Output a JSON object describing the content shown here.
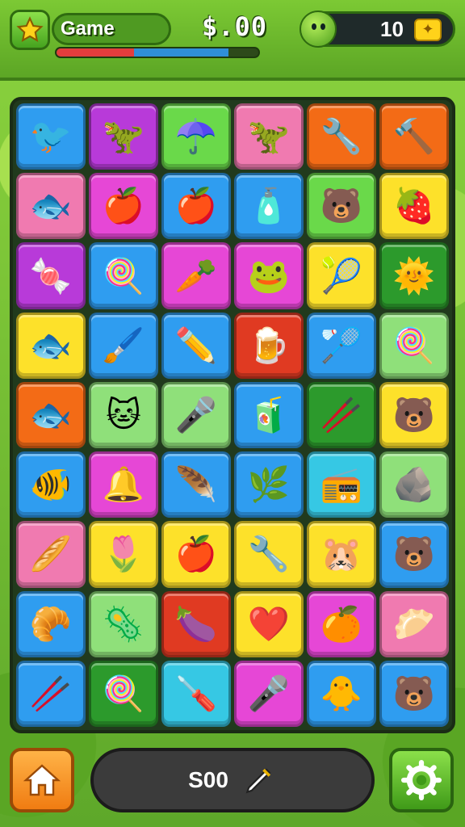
{
  "header": {
    "player_name": "Game",
    "money": "$.00",
    "progress": 0.85,
    "level": "10",
    "coin_icon": "coin-icon"
  },
  "footer": {
    "score": "S00"
  },
  "colors": {
    "blue": "#2f9df0",
    "purple": "#b83ad9",
    "green": "#6ad94a",
    "pink": "#f07ab0",
    "orange": "#f36b16",
    "yellow": "#fde12a",
    "magenta": "#e647d6",
    "dkgreen": "#2c9a2c",
    "red": "#e03a22",
    "teal": "#36c8e4",
    "ltgreen": "#8fe07a"
  },
  "board": {
    "rows": [
      [
        [
          "blue",
          "🐦"
        ],
        [
          "purple",
          "🦖"
        ],
        [
          "green",
          "☂️"
        ],
        [
          "pink",
          "🦖"
        ],
        [
          "orange",
          "🔧"
        ],
        [
          "orange",
          "🔨"
        ]
      ],
      [
        [
          "pink",
          "🐟"
        ],
        [
          "magenta",
          "🍎"
        ],
        [
          "blue",
          "🍎"
        ],
        [
          "blue",
          "🧴"
        ],
        [
          "green",
          "🐻"
        ],
        [
          "yellow",
          "🍓"
        ]
      ],
      [
        [
          "purple",
          "🍬"
        ],
        [
          "blue",
          "🍭"
        ],
        [
          "magenta",
          "🥕"
        ],
        [
          "magenta",
          "🐸"
        ],
        [
          "yellow",
          "🎾"
        ],
        [
          "dkgreen",
          "🌞"
        ]
      ],
      [
        [
          "yellow",
          "🐟"
        ],
        [
          "blue",
          "🖌️"
        ],
        [
          "blue",
          "✏️"
        ],
        [
          "red",
          "🍺"
        ],
        [
          "blue",
          "🏸"
        ],
        [
          "ltgreen",
          "🍭"
        ]
      ],
      [
        [
          "orange",
          "🐟"
        ],
        [
          "ltgreen",
          "🐱"
        ],
        [
          "ltgreen",
          "🎤"
        ],
        [
          "blue",
          "🧃"
        ],
        [
          "dkgreen",
          "🥢"
        ],
        [
          "yellow",
          "🐻"
        ]
      ],
      [
        [
          "blue",
          "🐠"
        ],
        [
          "magenta",
          "🔔"
        ],
        [
          "blue",
          "🪶"
        ],
        [
          "blue",
          "🌿"
        ],
        [
          "teal",
          "📻"
        ],
        [
          "ltgreen",
          "🪨"
        ]
      ],
      [
        [
          "pink",
          "🥖"
        ],
        [
          "yellow",
          "🌷"
        ],
        [
          "yellow",
          "🍎"
        ],
        [
          "yellow",
          "🔧"
        ],
        [
          "yellow",
          "🐹"
        ],
        [
          "blue",
          "🐻"
        ]
      ],
      [
        [
          "blue",
          "🥐"
        ],
        [
          "ltgreen",
          "🦠"
        ],
        [
          "red",
          "🍆"
        ],
        [
          "yellow",
          "❤️"
        ],
        [
          "magenta",
          "🍊"
        ],
        [
          "pink",
          "🥟"
        ]
      ],
      [
        [
          "blue",
          "🥢"
        ],
        [
          "dkgreen",
          "🍭"
        ],
        [
          "teal",
          "🪛"
        ],
        [
          "magenta",
          "🎤"
        ],
        [
          "blue",
          "🐥"
        ],
        [
          "blue",
          "🐻"
        ]
      ]
    ]
  }
}
